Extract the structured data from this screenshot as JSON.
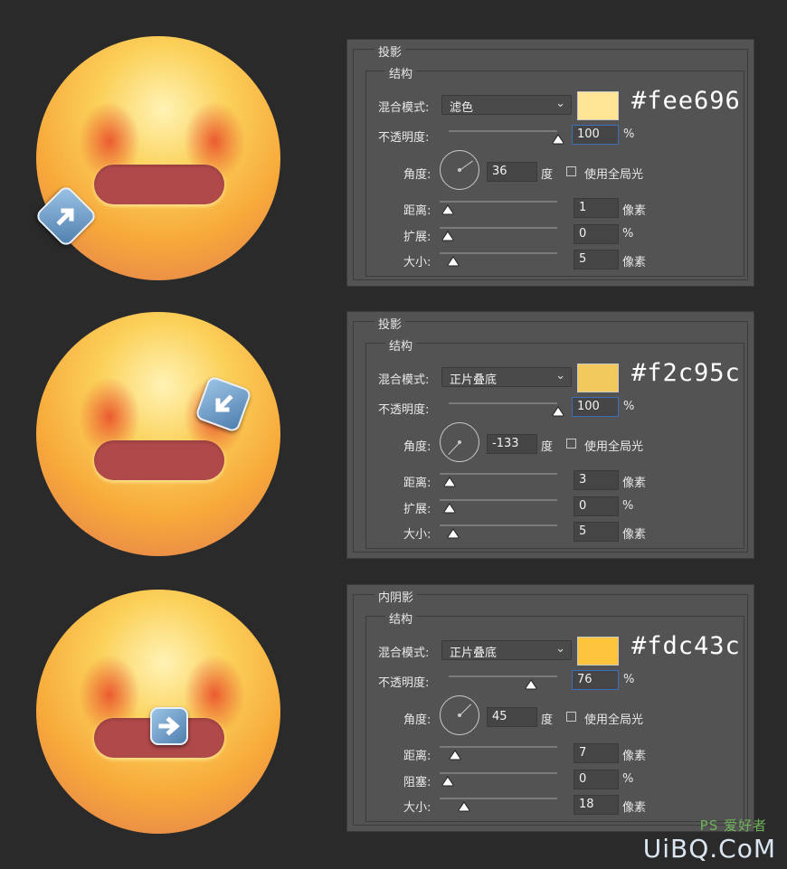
{
  "emojis": [
    {
      "arrow": "arrow-up-right-icon"
    },
    {
      "arrow": "arrow-down-left-icon"
    },
    {
      "arrow": "arrow-right-icon"
    }
  ],
  "panels": [
    {
      "section": "投影",
      "structure": "结构",
      "blend_label": "混合模式:",
      "blend_value": "滤色",
      "color": "#fee696",
      "hex_label": "#fee696",
      "opacity_label": "不透明度:",
      "opacity": "100",
      "opacity_unit": "%",
      "angle_label": "角度:",
      "angle": "36",
      "angle_unit": "度",
      "global_light": "使用全局光",
      "distance_label": "距离:",
      "distance": "1",
      "distance_unit": "像素",
      "spread_label": "扩展:",
      "spread": "0",
      "spread_unit": "%",
      "size_label": "大小:",
      "size": "5",
      "size_unit": "像素"
    },
    {
      "section": "投影",
      "structure": "结构",
      "blend_label": "混合模式:",
      "blend_value": "正片叠底",
      "color": "#f2c95c",
      "hex_label": "#f2c95c",
      "opacity_label": "不透明度:",
      "opacity": "100",
      "opacity_unit": "%",
      "angle_label": "角度:",
      "angle": "-133",
      "angle_unit": "度",
      "global_light": "使用全局光",
      "distance_label": "距离:",
      "distance": "3",
      "distance_unit": "像素",
      "spread_label": "扩展:",
      "spread": "0",
      "spread_unit": "%",
      "size_label": "大小:",
      "size": "5",
      "size_unit": "像素"
    },
    {
      "section": "内阴影",
      "structure": "结构",
      "blend_label": "混合模式:",
      "blend_value": "正片叠底",
      "color": "#fdc43c",
      "hex_label": "#fdc43c",
      "opacity_label": "不透明度:",
      "opacity": "76",
      "opacity_unit": "%",
      "angle_label": "角度:",
      "angle": "45",
      "angle_unit": "度",
      "global_light": "使用全局光",
      "distance_label": "距离:",
      "distance": "7",
      "distance_unit": "像素",
      "spread_label": "阻塞:",
      "spread": "0",
      "spread_unit": "%",
      "size_label": "大小:",
      "size": "18",
      "size_unit": "像素"
    }
  ],
  "watermark": {
    "text": "UiBQ.CoM",
    "sub": "PS 爱好者"
  }
}
